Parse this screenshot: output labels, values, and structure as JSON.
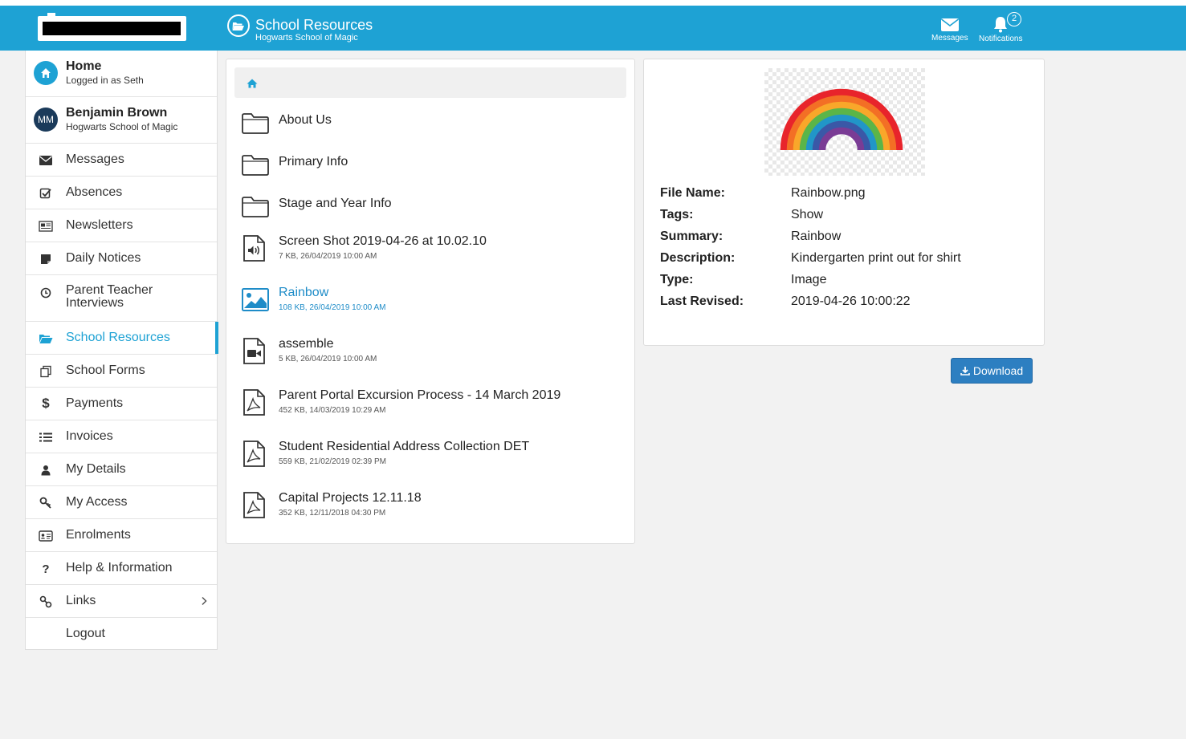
{
  "header": {
    "title": "School Resources",
    "subtitle": "Hogwarts School of Magic",
    "messages_label": "Messages",
    "notifications_label": "Notifications",
    "notifications_count": "2",
    "brand_color": "#1ea2d4"
  },
  "sidebar": {
    "home": {
      "title": "Home",
      "subtitle": "Logged in as Seth",
      "icon": "home-icon"
    },
    "profile": {
      "initials": "MM",
      "name": "Benjamin Brown",
      "school": "Hogwarts School of Magic"
    },
    "items": [
      {
        "label": "Messages",
        "icon": "envelope-icon"
      },
      {
        "label": "Absences",
        "icon": "check-square-icon"
      },
      {
        "label": "Newsletters",
        "icon": "newspaper-icon"
      },
      {
        "label": "Daily Notices",
        "icon": "note-icon"
      },
      {
        "label": "Parent Teacher Interviews",
        "icon": "clock-icon"
      },
      {
        "label": "School Resources",
        "icon": "folder-open-icon",
        "active": true
      },
      {
        "label": "School Forms",
        "icon": "forms-icon"
      },
      {
        "label": "Payments",
        "icon": "dollar-icon"
      },
      {
        "label": "Invoices",
        "icon": "list-icon"
      },
      {
        "label": "My Details",
        "icon": "user-icon"
      },
      {
        "label": "My Access",
        "icon": "key-icon"
      },
      {
        "label": "Enrolments",
        "icon": "id-card-icon"
      },
      {
        "label": "Help & Information",
        "icon": "question-icon"
      },
      {
        "label": "Links",
        "icon": "link-icon"
      },
      {
        "label": "Logout",
        "icon": ""
      }
    ]
  },
  "files": [
    {
      "name": "About Us",
      "meta": "",
      "type": "folder"
    },
    {
      "name": "Primary Info",
      "meta": "",
      "type": "folder"
    },
    {
      "name": "Stage and Year Info",
      "meta": "",
      "type": "folder"
    },
    {
      "name": "Screen Shot 2019-04-26 at 10.02.10",
      "meta": "7 KB, 26/04/2019 10:00 AM",
      "type": "audio"
    },
    {
      "name": "Rainbow",
      "meta": "108 KB, 26/04/2019 10:00 AM",
      "type": "image",
      "selected": true
    },
    {
      "name": "assemble",
      "meta": "5 KB, 26/04/2019 10:00 AM",
      "type": "video"
    },
    {
      "name": "Parent Portal Excursion Process - 14 March 2019",
      "meta": "452 KB, 14/03/2019 10:29 AM",
      "type": "pdf"
    },
    {
      "name": "Student Residential Address Collection DET",
      "meta": "559 KB, 21/02/2019 02:39 PM",
      "type": "pdf"
    },
    {
      "name": "Capital Projects 12.11.18",
      "meta": "352 KB, 12/11/2018 04:30 PM",
      "type": "pdf"
    }
  ],
  "detail": {
    "fields": [
      {
        "key": "File Name:",
        "value": "Rainbow.png"
      },
      {
        "key": "Tags:",
        "value": "Show"
      },
      {
        "key": "Summary:",
        "value": "Rainbow"
      },
      {
        "key": "Description:",
        "value": "Kindergarten print out for shirt"
      },
      {
        "key": "Type:",
        "value": "Image"
      },
      {
        "key": "Last Revised:",
        "value": "2019-04-26 10:00:22"
      }
    ],
    "download_label": "Download",
    "rainbow_colors": [
      "#e8242b",
      "#f36f25",
      "#f9a72a",
      "#5bb548",
      "#2196c8",
      "#3a58a7",
      "#7a3c95"
    ]
  }
}
